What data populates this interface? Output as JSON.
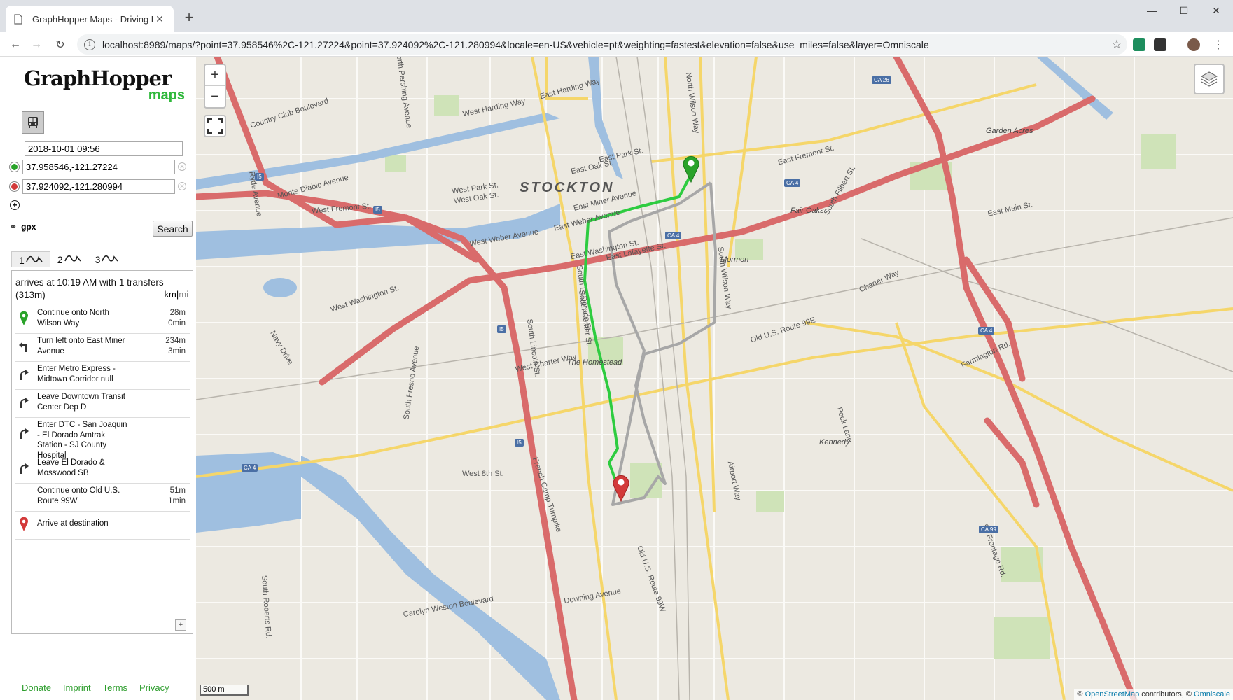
{
  "browser": {
    "tab_title": "GraphHopper Maps - Driving Di",
    "url": "localhost:8989/maps/?point=37.958546%2C-121.27224&point=37.924092%2C-121.280994&locale=en-US&vehicle=pt&weighting=fastest&elevation=false&use_miles=false&layer=Omniscale"
  },
  "sidebar": {
    "logo_main": "GraphHopper",
    "logo_sub": "maps",
    "departure": "2018-10-01 09:56",
    "from_point": "37.958546,-121.27224",
    "to_point": "37.924092,-121.280994",
    "gpx_label": "gpx",
    "search_label": "Search",
    "alternatives": [
      "1",
      "2",
      "3"
    ],
    "summary_line1": "arrives at 10:19 AM with 1 transfers",
    "summary_line2": "(313m)",
    "unit_km": "km",
    "unit_sep": "|",
    "unit_mi": "mi",
    "instructions": [
      {
        "text": "Continue onto North Wilson Way",
        "dist": "28m",
        "time": "0min",
        "icon": "start-marker-icon"
      },
      {
        "text": "Turn left onto East Miner Avenue",
        "dist": "234m",
        "time": "3min",
        "icon": "turn-left-icon"
      },
      {
        "text": "Enter Metro Express - Midtown Corridor null",
        "dist": "",
        "time": "",
        "icon": "enter-transit-icon"
      },
      {
        "text": "Leave Downtown Transit Center Dep D",
        "dist": "",
        "time": "",
        "icon": "leave-transit-icon"
      },
      {
        "text": "Enter DTC - San Joaquin - El Dorado Amtrak Station - SJ County Hospital",
        "dist": "",
        "time": "",
        "icon": "enter-transit-icon"
      },
      {
        "text": "Leave El Dorado & Mosswood SB",
        "dist": "",
        "time": "",
        "icon": "leave-transit-icon"
      },
      {
        "text": "Continue onto Old U.S. Route 99W",
        "dist": "51m",
        "time": "1min",
        "icon": "continue-icon"
      },
      {
        "text": "Arrive at destination",
        "dist": "",
        "time": "",
        "icon": "end-marker-icon"
      }
    ],
    "footer": {
      "donate": "Donate",
      "imprint": "Imprint",
      "terms": "Terms",
      "privacy": "Privacy"
    }
  },
  "map": {
    "city": "STOCKTON",
    "scale": "500 m",
    "attribution_prefix": "© ",
    "attribution_osm": "OpenStreetMap",
    "attribution_mid": " contributors, © ",
    "attribution_omni": "Omniscale",
    "road_labels": [
      "Country Club Boulevard",
      "Monte Diablo Avenue",
      "West Fremont St.",
      "West Weber Avenue",
      "West Washington St.",
      "West Harding Way",
      "East Harding Way",
      "East Park St.",
      "East Oak St.",
      "West Park St.",
      "West Oak St.",
      "East Miner Avenue",
      "East Weber Avenue",
      "East Washington St.",
      "East Lafayette St.",
      "East Fremont St.",
      "East Main St.",
      "Charter Way",
      "West Charter Way",
      "Navy Drive",
      "West 8th St.",
      "French Camp Turnpike",
      "Old U.S. Route 99E",
      "Old U.S. Route 99W",
      "Farmington Rd.",
      "Airport Way",
      "Carolyn Weston Boulevard",
      "Downing Avenue",
      "South Roberts Rd.",
      "Pock Lane",
      "Ryde Avenue",
      "North Pershing Avenue",
      "South El Dorado St.",
      "South Center St.",
      "South Lincoln St.",
      "South Fresno Avenue",
      "North Wilson Way",
      "South Wilson Way",
      "Fair Oaks",
      "South Filbert St.",
      "East Miner Avenue 2",
      "99 Frontage Rd."
    ],
    "place_labels": [
      "Garden Acres",
      "Mormon",
      "The Homestead",
      "Kennedy"
    ],
    "shields": [
      "I5",
      "I5",
      "I5",
      "I5",
      "CA 4",
      "CA 4",
      "CA 4",
      "CA 4",
      "CA 26",
      "CA 99"
    ]
  },
  "colors": {
    "route": "#2ecc40",
    "start": "#2aa32a",
    "end": "#d33a3a",
    "highway": "#d96b6b",
    "primary": "#f5d66a",
    "water": "#9fbfe0"
  }
}
